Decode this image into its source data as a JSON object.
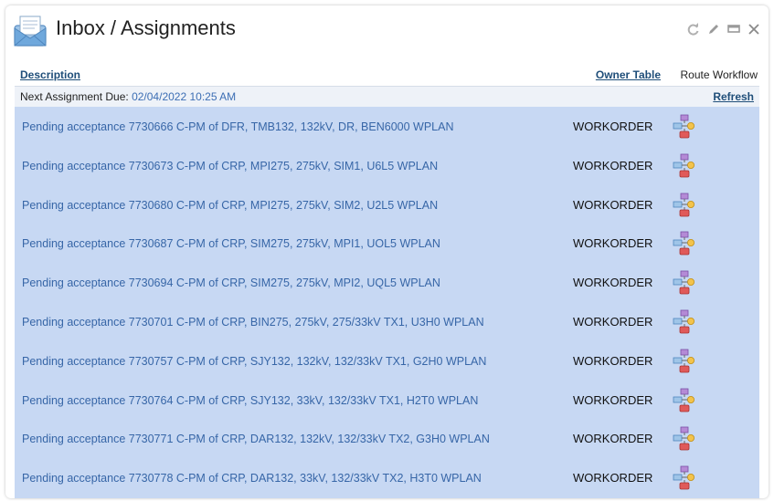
{
  "window": {
    "title": "Inbox / Assignments",
    "icons": [
      "envelope-icon",
      "refresh-icon",
      "edit-icon",
      "minimize-icon",
      "close-icon"
    ]
  },
  "header": {
    "description": "Description",
    "owner_table": "Owner Table",
    "route_workflow": "Route Workflow"
  },
  "due": {
    "label": "Next Assignment Due:",
    "value": "02/04/2022 10:25 AM",
    "refresh": "Refresh"
  },
  "rows": [
    {
      "description": "Pending acceptance 7730666 C-PM of DFR, TMB132, 132kV, DR, BEN6000 WPLAN",
      "owner": "WORKORDER"
    },
    {
      "description": "Pending acceptance 7730673 C-PM of CRP, MPI275, 275kV, SIM1, U6L5 WPLAN",
      "owner": "WORKORDER"
    },
    {
      "description": "Pending acceptance 7730680 C-PM of CRP, MPI275, 275kV, SIM2, U2L5 WPLAN",
      "owner": "WORKORDER"
    },
    {
      "description": "Pending acceptance 7730687 C-PM of CRP, SIM275, 275kV, MPI1, UOL5 WPLAN",
      "owner": "WORKORDER"
    },
    {
      "description": "Pending acceptance 7730694 C-PM of CRP, SIM275, 275kV, MPI2, UQL5 WPLAN",
      "owner": "WORKORDER"
    },
    {
      "description": "Pending acceptance 7730701 C-PM of CRP, BIN275, 275kV, 275/33kV TX1, U3H0 WPLAN",
      "owner": "WORKORDER"
    },
    {
      "description": "Pending acceptance 7730757 C-PM of CRP, SJY132, 132kV, 132/33kV TX1, G2H0 WPLAN",
      "owner": "WORKORDER"
    },
    {
      "description": "Pending acceptance 7730764 C-PM of CRP, SJY132, 33kV, 132/33kV TX1, H2T0 WPLAN",
      "owner": "WORKORDER"
    },
    {
      "description": "Pending acceptance 7730771 C-PM of CRP, DAR132, 132kV, 132/33kV TX2, G3H0 WPLAN",
      "owner": "WORKORDER"
    },
    {
      "description": "Pending acceptance 7730778 C-PM of CRP, DAR132, 33kV, 132/33kV TX2, H3T0 WPLAN",
      "owner": "WORKORDER"
    }
  ]
}
